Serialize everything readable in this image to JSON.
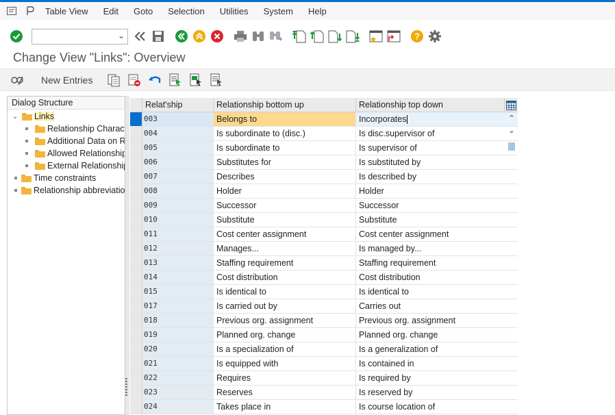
{
  "menu": {
    "items": [
      "Table View",
      "Edit",
      "Goto",
      "Selection",
      "Utilities",
      "System",
      "Help"
    ]
  },
  "toolbar": {
    "command_field_value": "",
    "icons": [
      "enter-check-icon",
      "back-icon",
      "save-icon",
      "back-green-icon",
      "exit-up-icon",
      "cancel-icon",
      "print-icon",
      "find-icon",
      "find-next-icon",
      "first-page-icon",
      "previous-page-icon",
      "next-page-icon",
      "last-page-icon",
      "new-session-icon",
      "shortcut-icon",
      "help-icon",
      "settings-gear-icon"
    ]
  },
  "title": "Change View \"Links\": Overview",
  "app_toolbar": {
    "new_entries_label": "New Entries",
    "icons": [
      "display-change-icon",
      "copy-icon",
      "delete-icon",
      "undo-icon",
      "select-all-icon",
      "select-block-icon",
      "deselect-all-icon"
    ]
  },
  "dialog_structure": {
    "header": "Dialog Structure",
    "items": [
      {
        "label": "Links",
        "level": 0,
        "expanded": true,
        "selected": true
      },
      {
        "label": "Relationship Characte",
        "level": 1
      },
      {
        "label": "Additional Data on Re",
        "level": 1
      },
      {
        "label": "Allowed Relationships",
        "level": 1
      },
      {
        "label": "External Relationships",
        "level": 1
      },
      {
        "label": "Time constraints",
        "level": 0
      },
      {
        "label": "Relationship abbreviation",
        "level": 0
      }
    ]
  },
  "table": {
    "columns": [
      "Relat'ship",
      "Relationship bottom up",
      "Relationship top down"
    ],
    "active_row": 0,
    "rows": [
      [
        "003",
        "Belongs to",
        "Incorporates"
      ],
      [
        "004",
        "Is subordinate to (disc.)",
        "Is disc.supervisor of"
      ],
      [
        "005",
        "Is subordinate to",
        "Is supervisor of"
      ],
      [
        "006",
        "Substitutes for",
        "Is substituted by"
      ],
      [
        "007",
        "Describes",
        "Is described by"
      ],
      [
        "008",
        "Holder",
        "Holder"
      ],
      [
        "009",
        "Successor",
        "Successor"
      ],
      [
        "010",
        "Substitute",
        "Substitute"
      ],
      [
        "011",
        "Cost center assignment",
        "Cost center assignment"
      ],
      [
        "012",
        "Manages...",
        "Is managed by..."
      ],
      [
        "013",
        "Staffing requirement",
        "Staffing requirement"
      ],
      [
        "014",
        "Cost distribution",
        "Cost distribution"
      ],
      [
        "015",
        "Is identical to",
        "Is identical to"
      ],
      [
        "017",
        "Is carried out by",
        "Carries out"
      ],
      [
        "018",
        "Previous org. assignment",
        "Previous org. assignment"
      ],
      [
        "019",
        "Planned org. change",
        "Planned org. change"
      ],
      [
        "020",
        "Is a specialization of",
        "Is a generalization of"
      ],
      [
        "021",
        "Is equipped with",
        "Is contained in"
      ],
      [
        "022",
        "Requires",
        "Is required by"
      ],
      [
        "023",
        "Reserves",
        "Is reserved by"
      ],
      [
        "024",
        "Takes place in",
        "Is course location of"
      ]
    ]
  }
}
